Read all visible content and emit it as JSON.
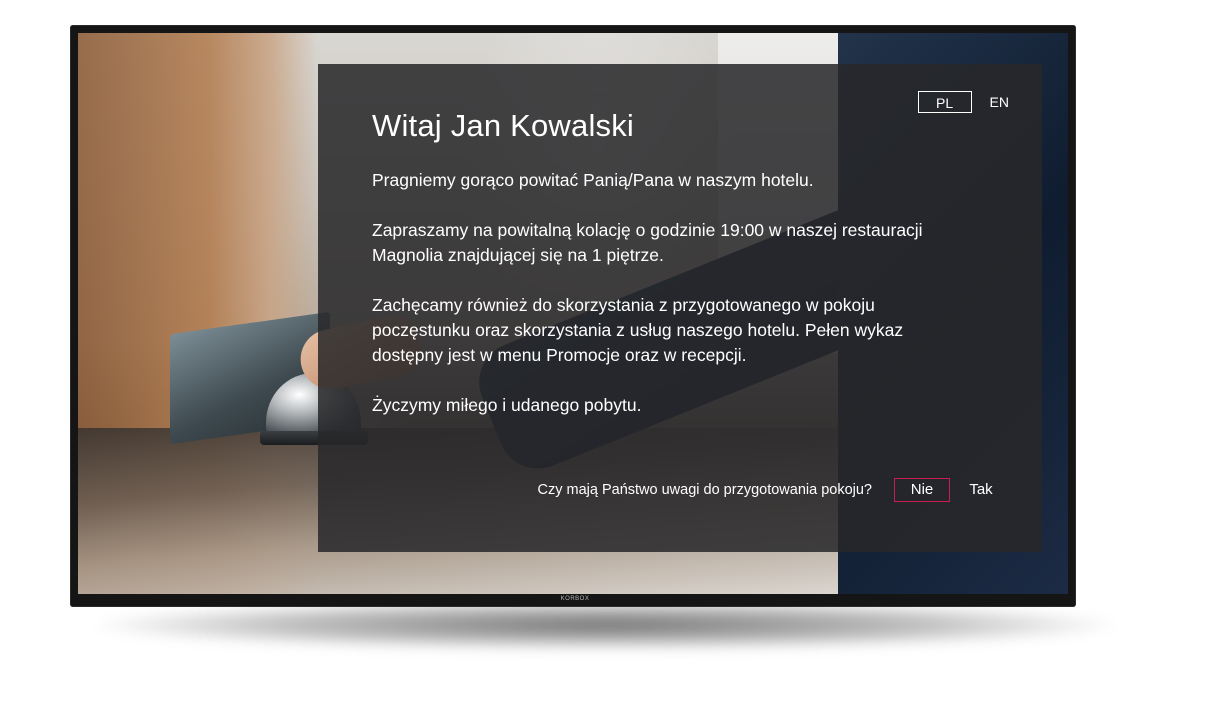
{
  "device": {
    "brand": "KORBOX"
  },
  "language_switch": {
    "options": [
      {
        "code": "PL",
        "selected": true
      },
      {
        "code": "EN",
        "selected": false
      }
    ]
  },
  "welcome": {
    "title": "Witaj Jan Kowalski",
    "paragraphs": [
      "Pragniemy gorąco powitać Panią/Pana w naszym hotelu.",
      "Zapraszamy na powitalną kolację o godzinie 19:00 w naszej restauracji Magnolia znajdującej się na 1 piętrze.",
      "Zachęcamy również do skorzystania z przygotowanego w pokoju poczęstunku oraz skorzystania z usług naszego hotelu. Pełen wykaz dostępny jest w menu Promocje oraz w recepcji.",
      "Życzymy miłego i udanego pobytu."
    ]
  },
  "room_question": {
    "text": "Czy mają Państwo uwagi do przygotowania pokoju?",
    "answers": [
      {
        "label": "Nie",
        "focused": true
      },
      {
        "label": "Tak",
        "focused": false
      }
    ]
  },
  "colors": {
    "focus_accent": "#c81d4f",
    "panel_background": "#28282a",
    "text": "#ffffff"
  }
}
